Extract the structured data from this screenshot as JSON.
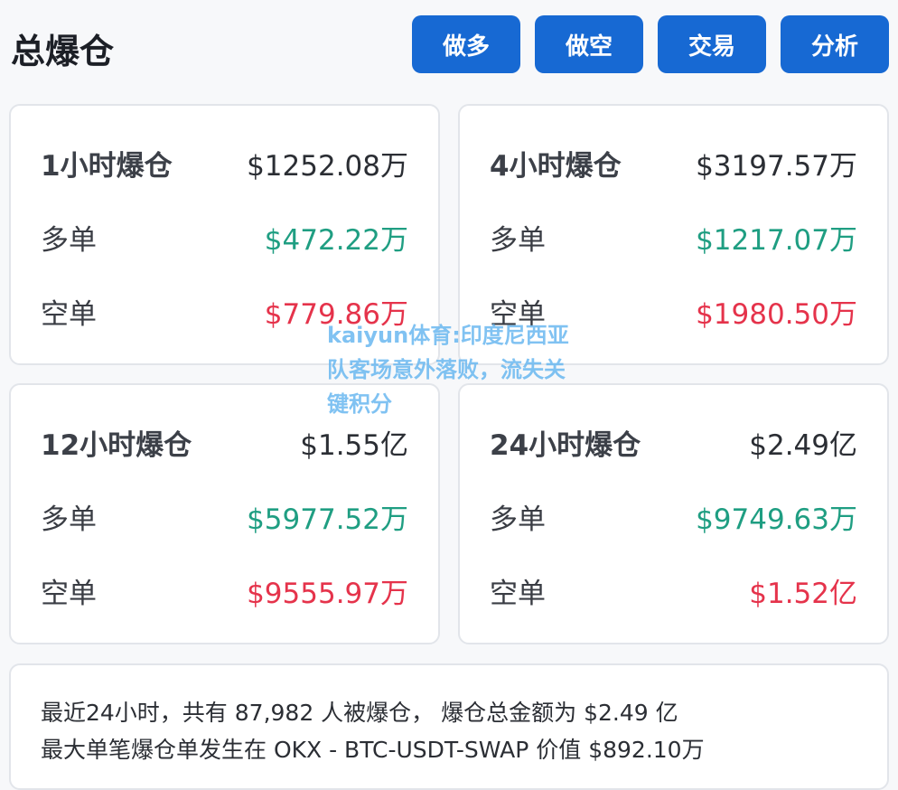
{
  "header": {
    "title": "总爆仓",
    "buttons": [
      "做多",
      "做空",
      "交易",
      "分析"
    ]
  },
  "cards": [
    {
      "label": "1小时爆仓",
      "total": "$1252.08万",
      "long_label": "多单",
      "long": "$472.22万",
      "short_label": "空单",
      "short": "$779.86万"
    },
    {
      "label": "4小时爆仓",
      "total": "$3197.57万",
      "long_label": "多单",
      "long": "$1217.07万",
      "short_label": "空单",
      "short": "$1980.50万"
    },
    {
      "label": "12小时爆仓",
      "total": "$1.55亿",
      "long_label": "多单",
      "long": "$5977.52万",
      "short_label": "空单",
      "short": "$9555.97万"
    },
    {
      "label": "24小时爆仓",
      "total": "$2.49亿",
      "long_label": "多单",
      "long": "$9749.63万",
      "short_label": "空单",
      "short": "$1.52亿"
    }
  ],
  "summary": {
    "line1": "最近24小时，共有 87,982 人被爆仓， 爆仓总金额为 $2.49 亿",
    "line2": "最大单笔爆仓单发生在 OKX - BTC-USDT-SWAP 价值 $892.10万"
  },
  "watermark": "kaiyun体育:印度尼西亚队客场意外落败，流失关键积分",
  "colors": {
    "accent": "#1769d3",
    "long": "#1f9e82",
    "short": "#e5334b"
  }
}
